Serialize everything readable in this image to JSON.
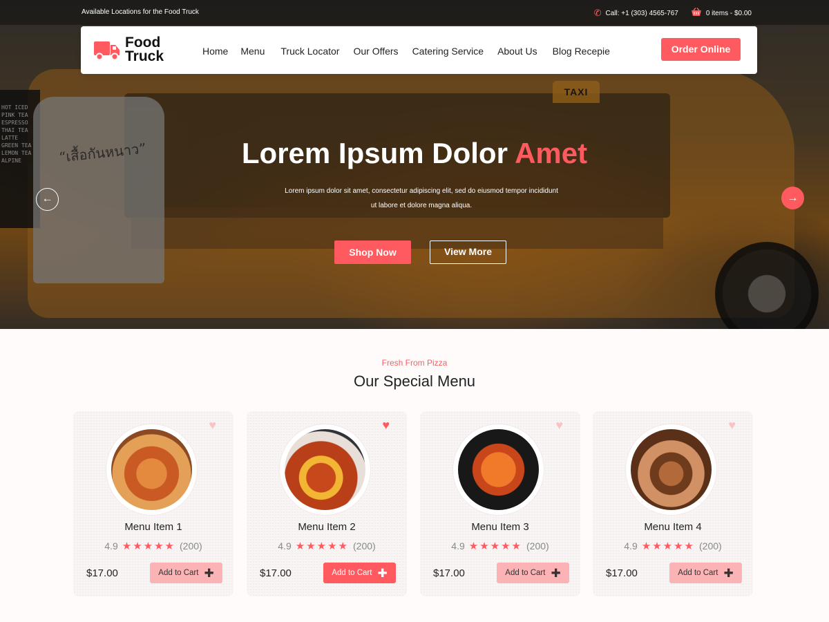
{
  "topbar": {
    "locations_text": "Available Locations for the Food Truck",
    "phone": "Call: +1 (303) 4565-767",
    "cart": "0 items - $0.00",
    "phone_icon": "phone-icon",
    "cart_icon": "basket-icon"
  },
  "brand": {
    "line1": "Food",
    "line2": "Truck",
    "color": "#ff5a5f"
  },
  "nav": {
    "items": [
      "Home",
      "Menu",
      "Truck Locator",
      "Our Offers",
      "Catering Service",
      "About Us",
      "Blog Recepie"
    ],
    "cta": "Order Online"
  },
  "hero": {
    "background_text": {
      "shirt": "“เสื้อกันหนาว”",
      "taxi": "TAXI",
      "board": "HOT ICED PINK TEA ESPRESSO THAI TEA LATTE GREEN TEA LEMON TEA ALPINE"
    },
    "title_main": "Lorem Ipsum Dolor",
    "title_accent": "Amet",
    "subtitle": "Lorem ipsum dolor sit amet, consectetur adipiscing elit, sed do eiusmod tempor incididunt ut labore et dolore magna aliqua.",
    "primary_btn": "Shop Now",
    "secondary_btn": "View More",
    "prev_icon": "arrow-left-icon",
    "next_icon": "arrow-right-icon"
  },
  "menu_section": {
    "kicker": "Fresh From Pizza",
    "title": "Our Special Menu",
    "cards": [
      {
        "name": "Menu Item 1",
        "rating": "4.9",
        "reviews": "(200)",
        "price": "$17.00",
        "cart_label": "Add to Cart",
        "favorited": false,
        "cart_active": false
      },
      {
        "name": "Menu Item 2",
        "rating": "4.9",
        "reviews": "(200)",
        "price": "$17.00",
        "cart_label": "Add to Cart",
        "favorited": true,
        "cart_active": true
      },
      {
        "name": "Menu Item 3",
        "rating": "4.9",
        "reviews": "(200)",
        "price": "$17.00",
        "cart_label": "Add to Cart",
        "favorited": false,
        "cart_active": false
      },
      {
        "name": "Menu Item 4",
        "rating": "4.9",
        "reviews": "(200)",
        "price": "$17.00",
        "cart_label": "Add to Cart",
        "favorited": false,
        "cart_active": false
      }
    ]
  }
}
